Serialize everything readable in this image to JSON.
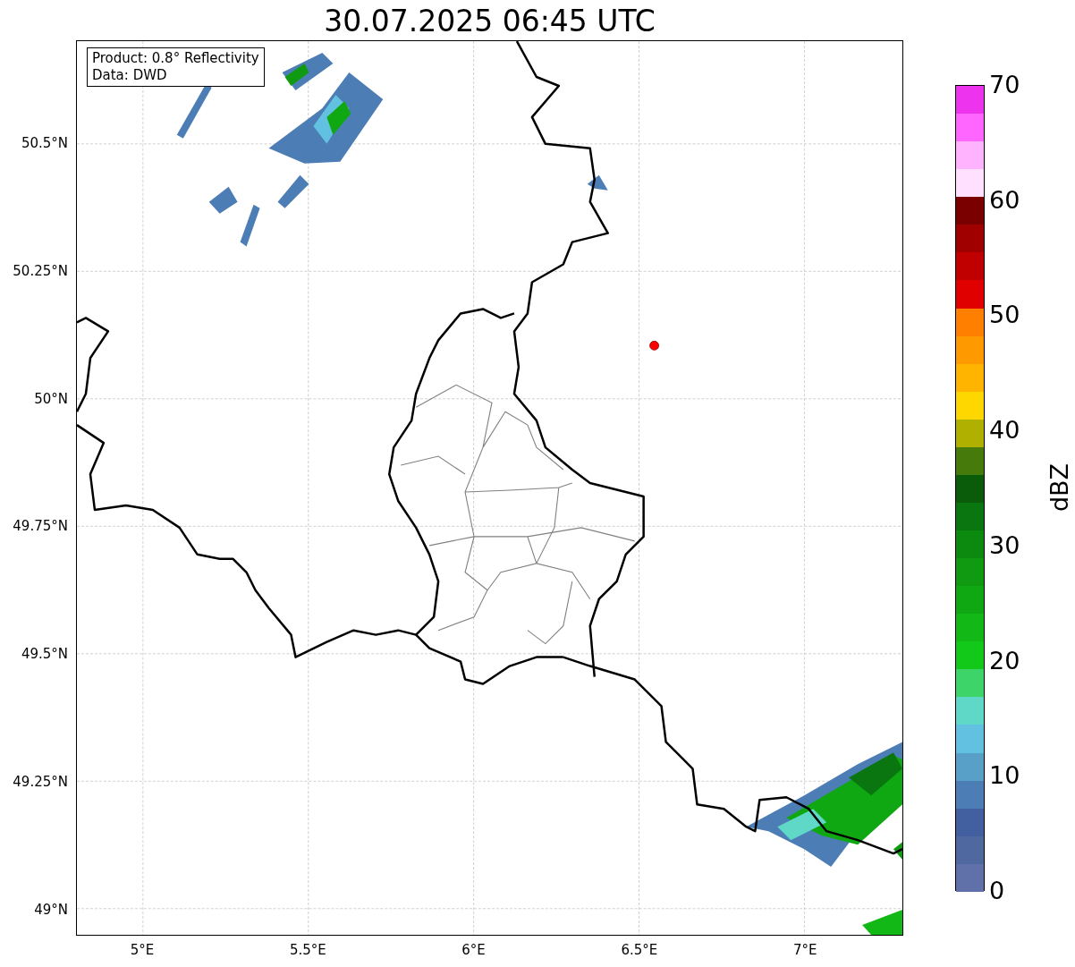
{
  "title": "30.07.2025 06:45 UTC",
  "legend": [
    "Product: 0.8° Reflectivity",
    "Data: DWD"
  ],
  "lat_ticks": [
    "50.5°N",
    "50.25°N",
    "50°N",
    "49.75°N",
    "49.5°N",
    "49.25°N",
    "49°N"
  ],
  "lon_ticks": [
    "5°E",
    "5.5°E",
    "6°E",
    "6.5°E",
    "7°E"
  ],
  "colorbar": {
    "label": "dBZ",
    "ticks": [
      "70",
      "60",
      "50",
      "40",
      "30",
      "20",
      "10",
      "0"
    ],
    "bands": [
      {
        "color": "#ee33ee"
      },
      {
        "color": "#ff66ff"
      },
      {
        "color": "#ffb3ff"
      },
      {
        "color": "#ffe0ff"
      },
      {
        "color": "#7a0000"
      },
      {
        "color": "#a00000"
      },
      {
        "color": "#c00000"
      },
      {
        "color": "#e00000"
      },
      {
        "color": "#ff7f00"
      },
      {
        "color": "#ff9900"
      },
      {
        "color": "#ffb400"
      },
      {
        "color": "#ffd700"
      },
      {
        "color": "#b0b000"
      },
      {
        "color": "#467a0a"
      },
      {
        "color": "#0a5c0a"
      },
      {
        "color": "#0a760f"
      },
      {
        "color": "#0c8a10"
      },
      {
        "color": "#0f9a12"
      },
      {
        "color": "#10a812"
      },
      {
        "color": "#12b815"
      },
      {
        "color": "#12c818"
      },
      {
        "color": "#3dd46a"
      },
      {
        "color": "#60d8c8"
      },
      {
        "color": "#62c0e0"
      },
      {
        "color": "#58a0c8"
      },
      {
        "color": "#4d7db5"
      },
      {
        "color": "#4260a0"
      },
      {
        "color": "#5068a0"
      },
      {
        "color": "#6070a8"
      }
    ]
  }
}
